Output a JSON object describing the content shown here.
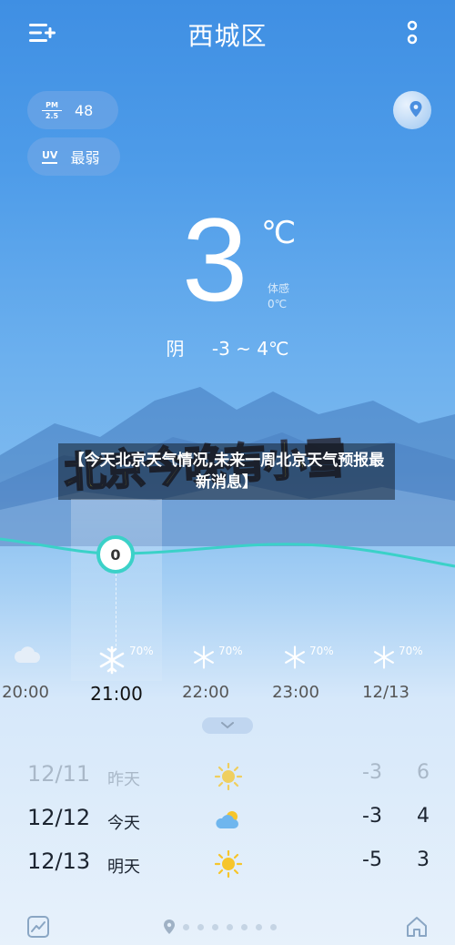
{
  "header": {
    "title": "西城区",
    "menu_icon": "add-city-menu-icon",
    "more_icon": "more-vertical-icon"
  },
  "air": {
    "pm_label_top": "PM",
    "pm_label_bottom": "2.5",
    "pm_value": "48",
    "uv_label": "UV",
    "uv_value": "最弱"
  },
  "current": {
    "temp": "3",
    "unit": "℃",
    "feels_label": "体感",
    "feels_value": "0℃",
    "condition": "阴",
    "range": "-3 ~ 4℃"
  },
  "headline": {
    "text": "【今天北京天气情况,未来一周北京天气预报最新消息】",
    "overlay_art": "北京今晚有小雪"
  },
  "hourly": {
    "current_temp": "0",
    "items": [
      {
        "time": "20:00",
        "icon": "cloud-icon",
        "pct": ""
      },
      {
        "time": "21:00",
        "icon": "snow-icon",
        "pct": "70%"
      },
      {
        "time": "22:00",
        "icon": "snow-icon",
        "pct": "70%"
      },
      {
        "time": "23:00",
        "icon": "snow-icon",
        "pct": "70%"
      },
      {
        "time": "12/13",
        "icon": "snow-icon",
        "pct": "70%"
      }
    ]
  },
  "daily": [
    {
      "date": "12/11",
      "name": "昨天",
      "icon": "sun-icon",
      "low": "-3",
      "high": "6"
    },
    {
      "date": "12/12",
      "name": "今天",
      "icon": "partly-cloudy-icon",
      "low": "-3",
      "high": "4"
    },
    {
      "date": "12/13",
      "name": "明天",
      "icon": "sun-icon",
      "low": "-5",
      "high": "3"
    }
  ],
  "colors": {
    "accent_teal": "#3bd1c8",
    "sun_yellow": "#f6c52b",
    "headline_art_yellow": "#f3e64a"
  }
}
